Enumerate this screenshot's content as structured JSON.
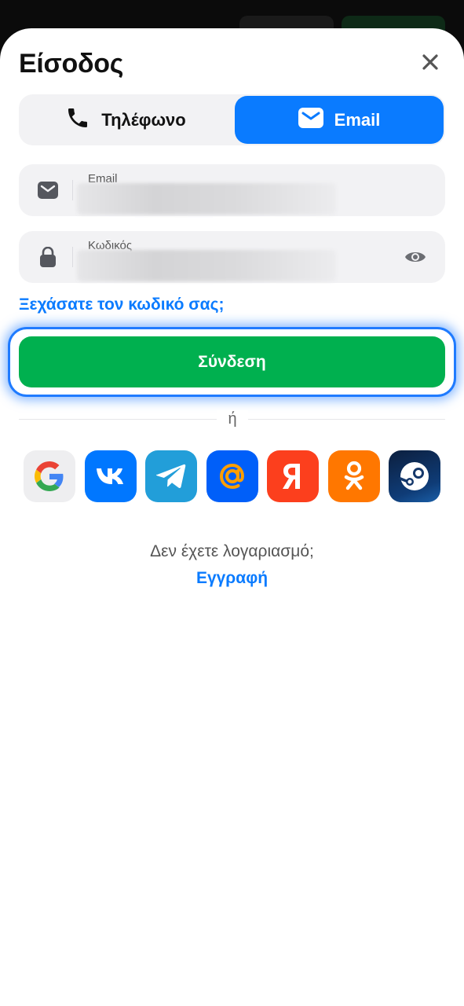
{
  "header": {
    "title": "Είσοδος"
  },
  "tabs": [
    {
      "label": "Τηλέφωνο",
      "icon": "phone-icon",
      "selected": false
    },
    {
      "label": "Email",
      "icon": "mail-icon",
      "selected": true
    }
  ],
  "fields": {
    "email": {
      "label": "Email",
      "icon": "mail-icon"
    },
    "password": {
      "label": "Κωδικός",
      "icon": "lock-icon"
    }
  },
  "forgot_label": "Ξεχάσατε τον κωδικό σας;",
  "submit_label": "Σύνδεση",
  "or_label": "ή",
  "socials": [
    "google",
    "vk",
    "telegram",
    "mail-ru",
    "yandex",
    "odnoklassniki",
    "steam"
  ],
  "footer": {
    "question": "Δεν έχετε λογαριασμό;",
    "register_label": "Εγγραφή"
  },
  "colors": {
    "accent": "#0a7bff",
    "success": "#00b04f",
    "focus": "#1f7bff"
  }
}
